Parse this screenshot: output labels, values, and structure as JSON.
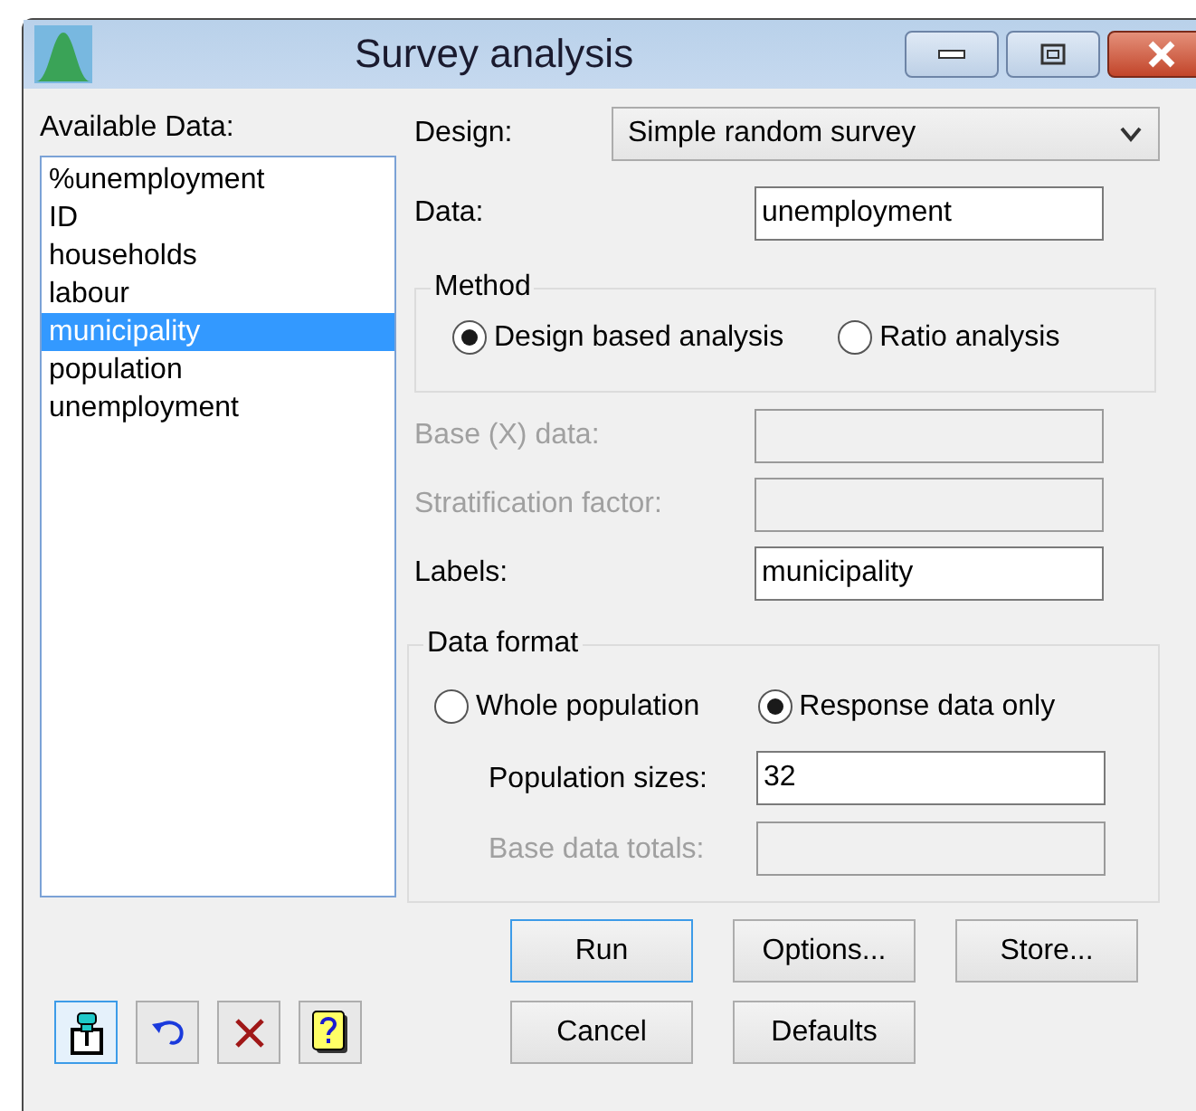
{
  "window": {
    "title": "Survey analysis"
  },
  "available_data": {
    "label": "Available Data:",
    "items": [
      {
        "label": "%unemployment",
        "selected": false
      },
      {
        "label": "ID",
        "selected": false
      },
      {
        "label": "households",
        "selected": false
      },
      {
        "label": "labour",
        "selected": false
      },
      {
        "label": "municipality",
        "selected": true
      },
      {
        "label": "population",
        "selected": false
      },
      {
        "label": "unemployment",
        "selected": false
      }
    ]
  },
  "design": {
    "label": "Design:",
    "value": "Simple random survey"
  },
  "data": {
    "label": "Data:",
    "value": "unemployment"
  },
  "method": {
    "title": "Method",
    "options": [
      {
        "label": "Design based analysis",
        "selected": true
      },
      {
        "label": "Ratio analysis",
        "selected": false
      }
    ]
  },
  "fields": [
    {
      "label": "Base (X) data:",
      "disabled": true
    },
    {
      "label": "Stratification factor:",
      "disabled": true
    },
    {
      "label": "Labels:",
      "value": "municipality",
      "disabled": false
    }
  ],
  "data_format": {
    "title": "Data format",
    "options": [
      {
        "label": "Whole population",
        "selected": false
      },
      {
        "label": "Response data only",
        "selected": true
      }
    ],
    "fields": [
      {
        "label": "Population sizes:",
        "value": "32",
        "disabled": false
      },
      {
        "label": "Base data totals:",
        "disabled": true
      }
    ]
  },
  "tool_buttons": [
    {
      "kind": "pin",
      "selected": true
    },
    {
      "kind": "undo",
      "selected": false
    },
    {
      "kind": "clear",
      "selected": false
    },
    {
      "kind": "help",
      "selected": false
    }
  ],
  "buttons": [
    [
      {
        "label": "Run",
        "default": true
      },
      {
        "label": "Options...",
        "default": false
      },
      {
        "label": "Store...",
        "default": false
      }
    ],
    [
      {
        "label": "Cancel",
        "default": false
      },
      {
        "label": "Defaults",
        "default": false
      }
    ]
  ]
}
